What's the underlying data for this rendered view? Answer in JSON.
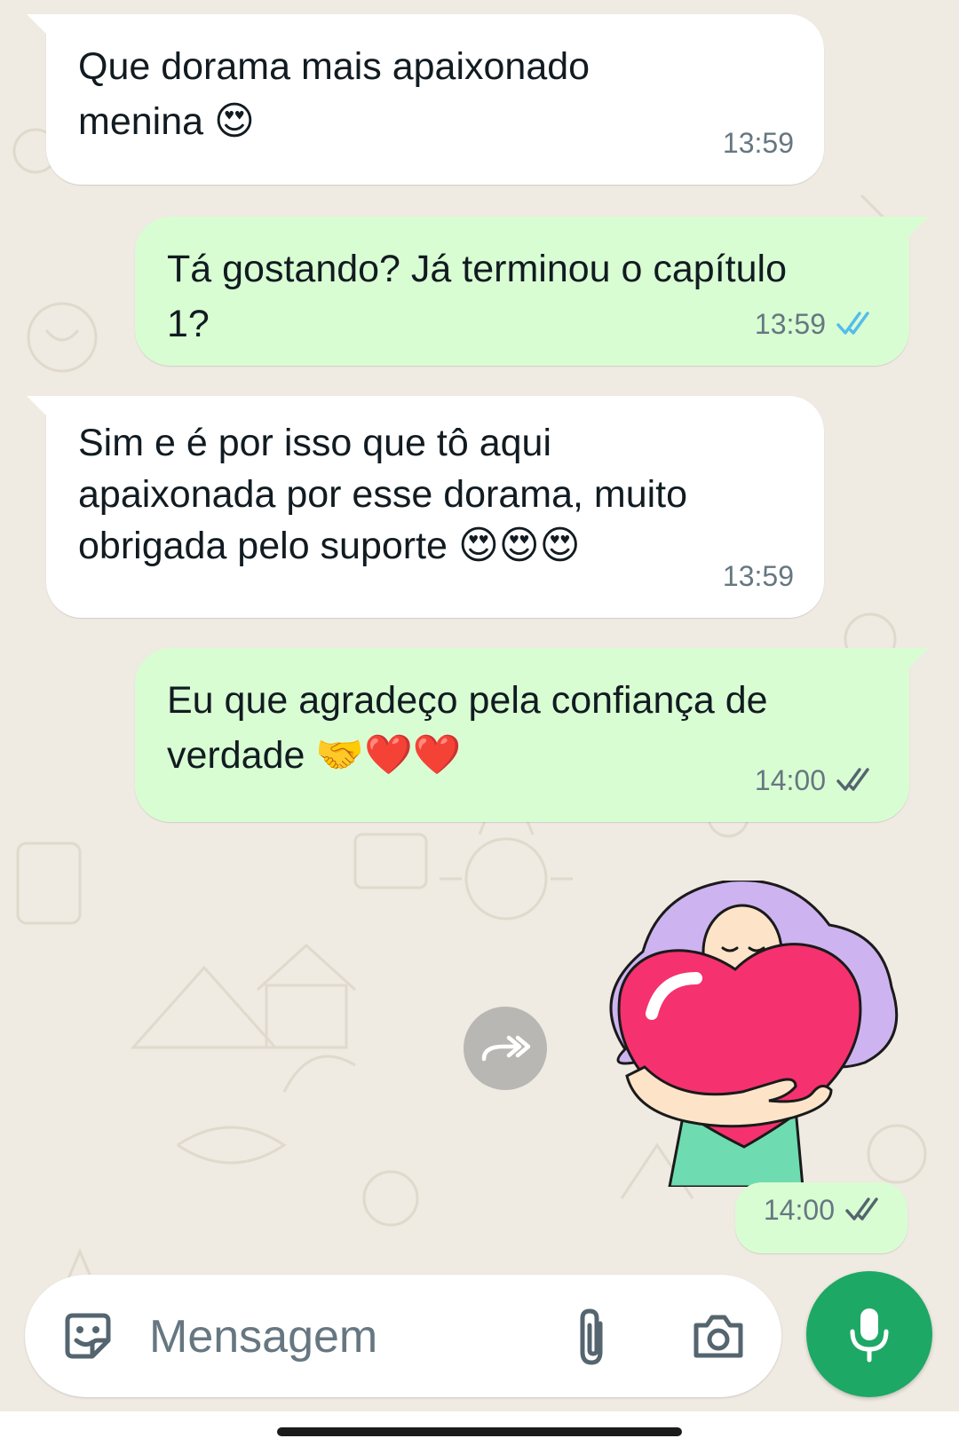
{
  "messages": [
    {
      "direction": "in",
      "text": "Que dorama mais apaixonado\nmenina",
      "emoji": "😍",
      "time": "13:59"
    },
    {
      "direction": "out",
      "text": "Tá gostando? Já terminou o capítulo\n1?",
      "emoji": "",
      "time": "13:59",
      "status": "read"
    },
    {
      "direction": "in",
      "text": "Sim e é por isso que tô aqui\napaixonada por esse dorama, muito\nobrigada pelo suporte",
      "emoji": "😍😍😍",
      "time": "13:59"
    },
    {
      "direction": "out",
      "text": "Eu que agradeço pela confiança de\nverdade",
      "emoji": "🤝❤️❤️",
      "time": "14:00",
      "status": "delivered"
    },
    {
      "direction": "out",
      "type": "sticker",
      "time": "14:00",
      "status": "delivered",
      "sticker": "girl-hugging-heart-sticker"
    }
  ],
  "composer": {
    "placeholder": "Mensagem",
    "icons": [
      "sticker-icon",
      "paperclip-icon",
      "camera-icon"
    ],
    "send_icon": "microphone-icon"
  },
  "colors": {
    "incoming_bubble": "#ffffff",
    "outgoing_bubble": "#d9fdd3",
    "read_ticks": "#53bdeb",
    "delivered_ticks": "#667781",
    "mic_button": "#1da865",
    "wallpaper": "#efeae2"
  }
}
